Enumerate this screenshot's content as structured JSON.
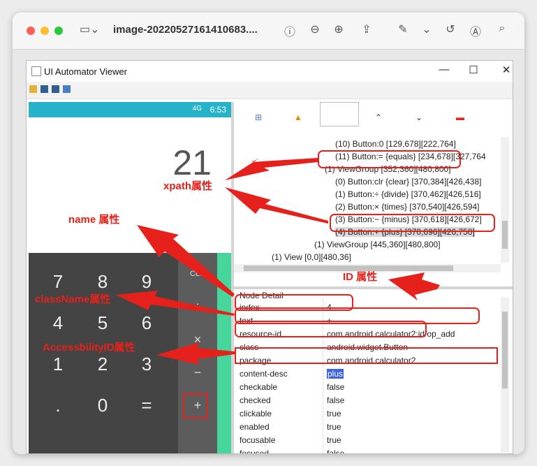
{
  "mac": {
    "title": "image-20220527161410683....",
    "sidebar_icon": "sidebar-icon",
    "toolbar_icons": [
      "info-icon",
      "zoom-out-icon",
      "zoom-in-icon",
      "share-icon",
      "markup-icon",
      "rotate-icon",
      "annotate-icon",
      "search-icon"
    ]
  },
  "window": {
    "title": "UI Automator Viewer",
    "controls": {
      "minimize": "—",
      "maximize": "☐",
      "close": "✕"
    }
  },
  "phone": {
    "status_time": "6:53",
    "status_signal": "4G",
    "display": "21",
    "keys": [
      "7",
      "8",
      "9",
      "4",
      "5",
      "6",
      "1",
      "2",
      "3",
      ".",
      "0",
      "="
    ],
    "ops": [
      "CLR",
      "÷",
      "×",
      "−",
      "+"
    ]
  },
  "tree": {
    "nodes": [
      "(10) Button:0 [129,678][222,764]",
      "(11) Button:= {equals} [234,678][327,764",
      "(1) ViewGroup [352,360][480,800]",
      "(0) Button:clr {clear} [370,384][426,438]",
      "(1) Button:÷ {divide} [370,462][426,516]",
      "(2) Button:× {times} [370,540][426,594]",
      "(3) Button:− {minus} [370,618][426,672]",
      "(4) Button:+ {plus} [370,696][426,750]",
      "(1) ViewGroup [445,360][480,800]",
      "(1) View [0,0][480,36]"
    ]
  },
  "detail": {
    "header": "Node Detail",
    "rows": [
      {
        "k": "index",
        "v": "4"
      },
      {
        "k": "text",
        "v": "+"
      },
      {
        "k": "resource-id",
        "v": "com.android.calculator2:id/op_add"
      },
      {
        "k": "class",
        "v": "android.widget.Button"
      },
      {
        "k": "package",
        "v": "com.android.calculator2"
      },
      {
        "k": "content-desc",
        "v": "plus"
      },
      {
        "k": "checkable",
        "v": "false"
      },
      {
        "k": "checked",
        "v": "false"
      },
      {
        "k": "clickable",
        "v": "true"
      },
      {
        "k": "enabled",
        "v": "true"
      },
      {
        "k": "focusable",
        "v": "true"
      },
      {
        "k": "focused",
        "v": "false"
      }
    ]
  },
  "annotations": {
    "xpath": "xpath属性",
    "name": "name 属性",
    "classname": "className属性",
    "accessibility": "AccessbilityID属性",
    "id": "ID 属性"
  },
  "colors": {
    "accent": "#e6211c",
    "status_bar": "#26b3c9",
    "highlight": "#3f63d8",
    "calc_green": "#46d59a"
  }
}
